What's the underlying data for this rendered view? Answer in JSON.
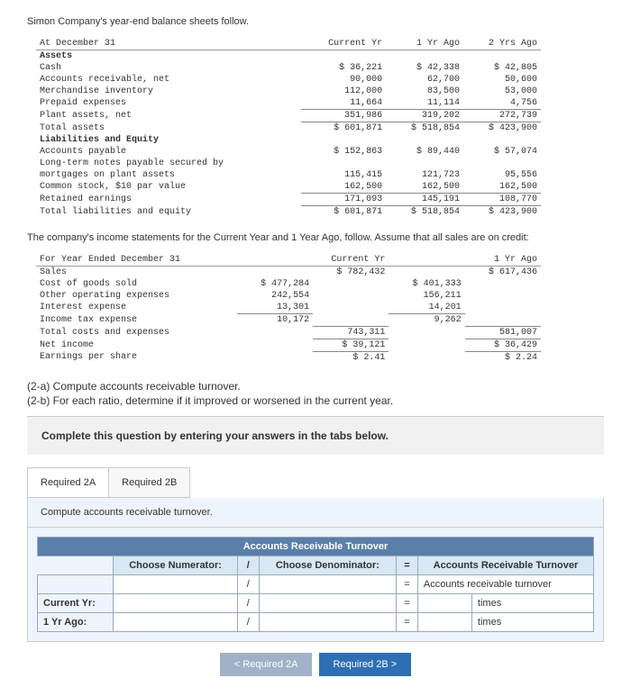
{
  "intro1": "Simon Company's year-end balance sheets follow.",
  "bs": {
    "head": {
      "c0": "At December 31",
      "c1": "Current Yr",
      "c2": "1 Yr Ago",
      "c3": "2 Yrs Ago"
    },
    "assets_label": "Assets",
    "rows": [
      {
        "n": "Cash",
        "a": "$ 36,221",
        "b": "$  42,338",
        "c": "$  42,805"
      },
      {
        "n": "Accounts receivable, net",
        "a": "90,000",
        "b": "62,700",
        "c": "50,600"
      },
      {
        "n": "Merchandise inventory",
        "a": "112,000",
        "b": "83,500",
        "c": "53,000"
      },
      {
        "n": "Prepaid expenses",
        "a": "11,664",
        "b": "11,114",
        "c": "4,756"
      },
      {
        "n": "Plant assets, net",
        "a": "351,986",
        "b": "319,202",
        "c": "272,739"
      }
    ],
    "total_assets": {
      "n": "Total assets",
      "a": "$ 601,871",
      "b": "$ 518,854",
      "c": "$ 423,900"
    },
    "liab_label": "Liabilities and Equity",
    "lrows": [
      {
        "n": "Accounts payable",
        "a": "$ 152,863",
        "b": "$  89,440",
        "c": "$  57,074"
      },
      {
        "n": "Long-term notes payable secured by",
        "a": "",
        "b": "",
        "c": ""
      },
      {
        "n": "  mortgages on plant assets",
        "a": "115,415",
        "b": "121,723",
        "c": "95,556"
      },
      {
        "n": "Common stock, $10 par value",
        "a": "162,500",
        "b": "162,500",
        "c": "162,500"
      },
      {
        "n": "Retained earnings",
        "a": "171,093",
        "b": "145,191",
        "c": "108,770"
      }
    ],
    "total_le": {
      "n": "Total liabilities and equity",
      "a": "$ 601,871",
      "b": "$ 518,854",
      "c": "$ 423,900"
    }
  },
  "intro2": "The company's income statements for the Current Year and 1 Year Ago, follow. Assume that all sales are on credit:",
  "is": {
    "head": {
      "c0": "For Year Ended December 31",
      "c1": "Current Yr",
      "c2": "1 Yr Ago"
    },
    "sales": {
      "n": "Sales",
      "a": "$ 782,432",
      "b": "$ 617,436"
    },
    "rows": [
      {
        "n": "Cost of goods sold",
        "a": "$ 477,284",
        "b": "$ 401,333"
      },
      {
        "n": "Other operating expenses",
        "a": "242,554",
        "b": "156,211"
      },
      {
        "n": "Interest expense",
        "a": "13,301",
        "b": "14,201"
      },
      {
        "n": "Income tax expense",
        "a": "10,172",
        "b": "9,262"
      }
    ],
    "tce": {
      "n": "Total costs and expenses",
      "a": "743,311",
      "b": "581,007"
    },
    "ni": {
      "n": "Net income",
      "a": "$  39,121",
      "b": "$  36,429"
    },
    "eps": {
      "n": "Earnings per share",
      "a": "$    2.41",
      "b": "$    2.24"
    }
  },
  "q": {
    "a": "(2-a) Compute accounts receivable turnover.",
    "b": "(2-b) For each ratio, determine if it improved or worsened in the current year."
  },
  "instr": "Complete this question by entering your answers in the tabs below.",
  "tabs": {
    "a": "Required 2A",
    "b": "Required 2B"
  },
  "tab_body": "Compute accounts receivable turnover.",
  "tbl": {
    "title": "Accounts Receivable Turnover",
    "h1": "Choose Numerator:",
    "op1": "/",
    "h2": "Choose Denominator:",
    "op2": "=",
    "h3": "Accounts Receivable Turnover",
    "result_label": "Accounts receivable turnover",
    "unit": "times",
    "r1": "Current Yr:",
    "r2": "1 Yr Ago:"
  },
  "nav": {
    "prev": "<  Required 2A",
    "next": "Required 2B  >"
  }
}
